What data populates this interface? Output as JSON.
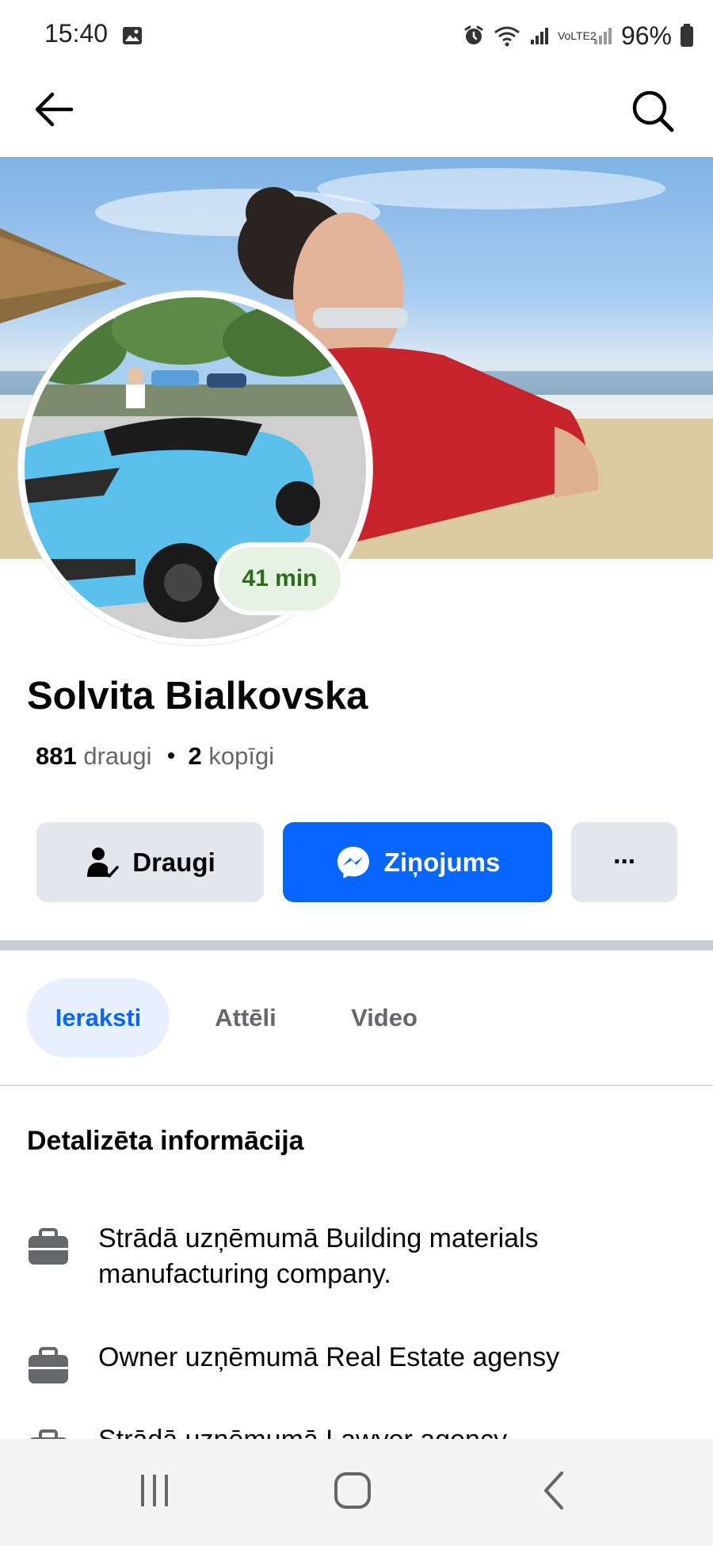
{
  "status_bar": {
    "time": "15:40",
    "network_label": "VoLTE2",
    "battery": "96%"
  },
  "app_bar": {
    "back_icon": "arrow-left-icon",
    "search_icon": "search-icon"
  },
  "profile": {
    "name": "Solvita Bialkovska",
    "active_time": "41 min",
    "friends_count": "881",
    "friends_label": "draugi",
    "mutual_count": "2",
    "mutual_label": "kopīgi"
  },
  "actions": {
    "friends_label": "Draugi",
    "message_label": "Ziņojums",
    "more_label": "···"
  },
  "tabs": [
    {
      "label": "Ieraksti",
      "active": true
    },
    {
      "label": "Attēli",
      "active": false
    },
    {
      "label": "Video",
      "active": false
    }
  ],
  "details": {
    "title": "Detalizēta informācija",
    "items": [
      {
        "icon": "briefcase-icon",
        "text": "Strādā uzņēmumā Building materials manufacturing company."
      },
      {
        "icon": "briefcase-icon",
        "text": "Owner uzņēmumā Real Estate agensy"
      },
      {
        "icon": "briefcase-icon",
        "text": "Strādā uzņēmumā Lawyer agency"
      }
    ]
  },
  "colors": {
    "primary": "#0866ff",
    "button_gray": "#e4e6eb",
    "active_tab_bg": "#e7f0fd",
    "active_pill_bg": "#e7f3e2",
    "active_pill_text": "#2f6b1f"
  },
  "nav_bar": {
    "recent_icon": "recent-apps-icon",
    "home_icon": "home-icon",
    "back_icon": "nav-back-icon"
  }
}
